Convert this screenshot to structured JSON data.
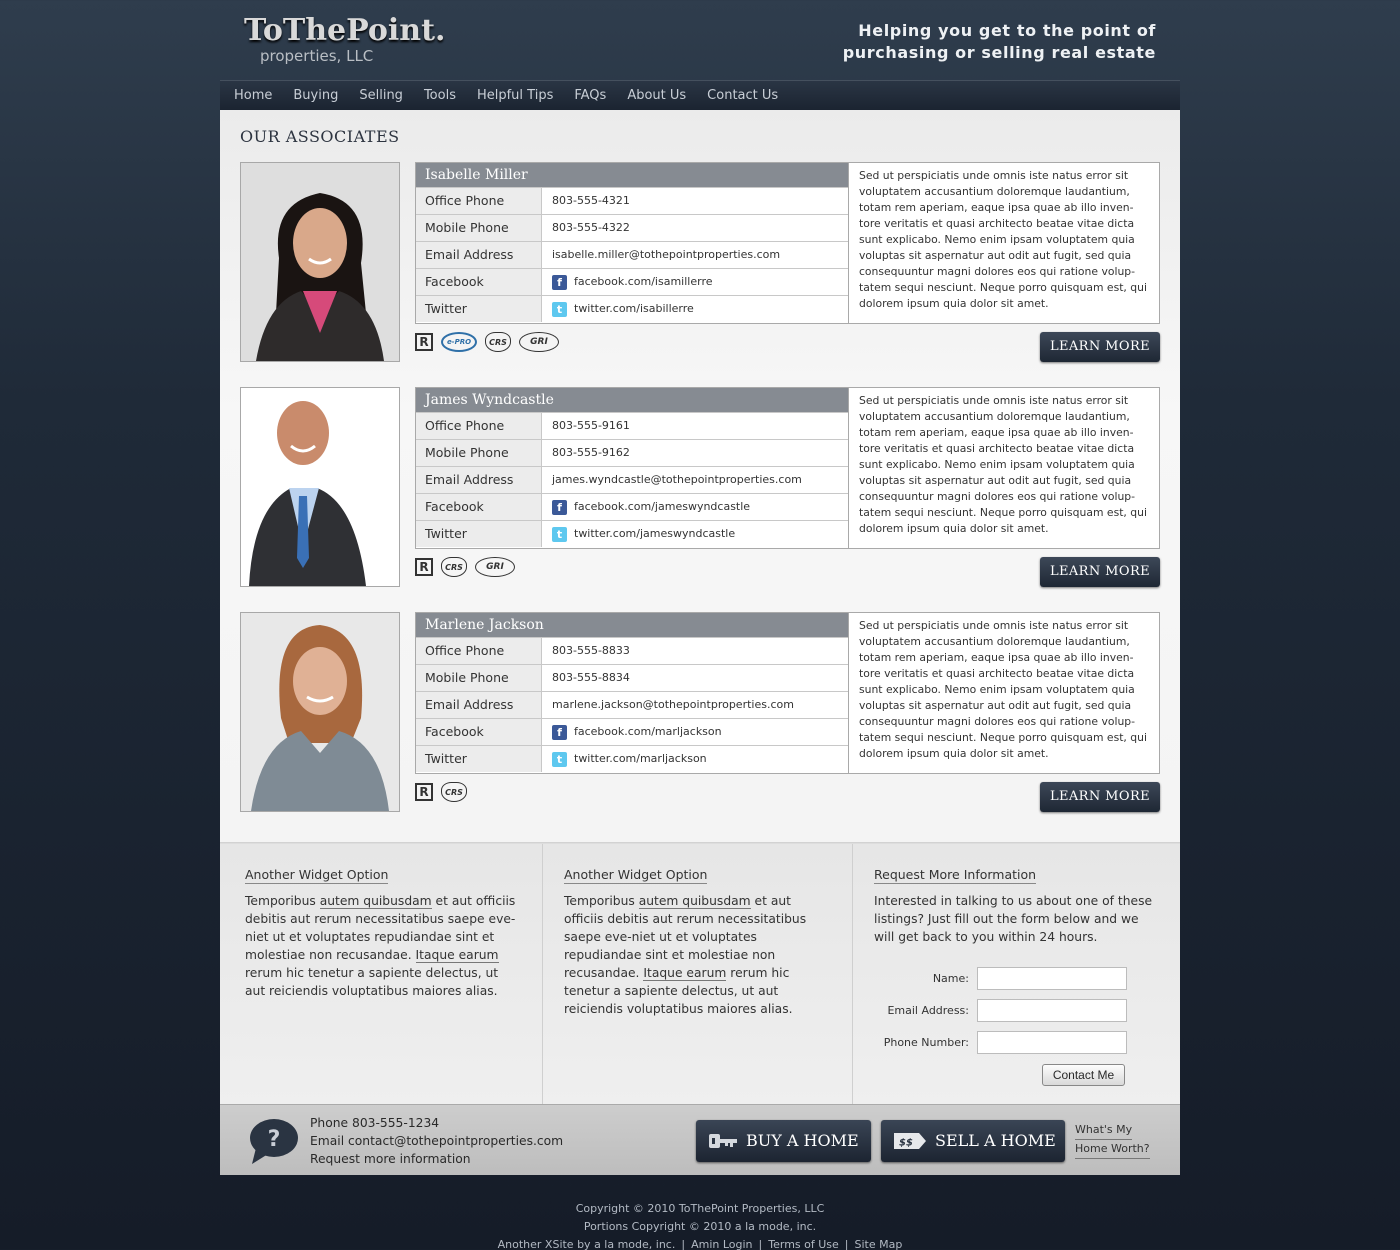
{
  "header": {
    "logo_main": "ToThePoint.",
    "logo_sub": "properties, LLC",
    "tagline_line1": "Helping you get to the point of",
    "tagline_line2": "purchasing or selling real estate"
  },
  "nav": [
    "Home",
    "Buying",
    "Selling",
    "Tools",
    "Helpful Tips",
    "FAQs",
    "About Us",
    "Contact Us"
  ],
  "section_title": "OUR ASSOCIATES",
  "labels": {
    "office": "Office Phone",
    "mobile": "Mobile Phone",
    "email": "Email Address",
    "facebook": "Facebook",
    "twitter": "Twitter",
    "learn_more": "LEARN MORE"
  },
  "bio": "Sed ut perspiciatis unde omnis iste natus error sit voluptatem accusantium doloremque laudantium, totam rem aperiam, eaque ipsa quae ab illo inven-tore veritatis et quasi architecto beatae vitae dicta sunt explicabo. Nemo enim ipsam voluptatem quia voluptas sit aspernatur aut odit aut fugit, sed quia consequuntur magni dolores eos qui ratione volup-tatem sequi nesciunt. Neque porro quisquam est, qui dolorem ipsum quia dolor sit amet.",
  "associates": [
    {
      "name": "Isabelle Miller",
      "office": "803-555-4321",
      "mobile": "803-555-4322",
      "email": "isabelle.miller@tothepointproperties.com",
      "facebook": "facebook.com/isamillerre",
      "twitter": "twitter.com/isabillerre",
      "badges": [
        "R",
        "e-PRO",
        "CRS",
        "GRI"
      ]
    },
    {
      "name": "James Wyndcastle",
      "office": "803-555-9161",
      "mobile": "803-555-9162",
      "email": "james.wyndcastle@tothepointproperties.com",
      "facebook": "facebook.com/jameswyndcastle",
      "twitter": "twitter.com/jameswyndcastle",
      "badges": [
        "R",
        "CRS",
        "GRI"
      ]
    },
    {
      "name": "Marlene Jackson",
      "office": "803-555-8833",
      "mobile": "803-555-8834",
      "email": "marlene.jackson@tothepointproperties.com",
      "facebook": "facebook.com/marljackson",
      "twitter": "twitter.com/marljackson",
      "badges": [
        "R",
        "CRS"
      ]
    }
  ],
  "widgets": {
    "w1_title": "Another Widget Option",
    "w2_title": "Another Widget Option",
    "text_a": "Temporibus ",
    "text_link1": "autem quibusdam",
    "text_b": " et aut officiis debitis aut rerum necessitatibus saepe eve-niet ut et voluptates repudiandae sint et molestiae non recusandae. ",
    "text_link2": "Itaque earum",
    "text_c": " rerum hic tenetur a sapiente delectus, ut aut reiciendis voluptatibus maiores alias.",
    "w3_title": "Request More Information",
    "w3_text": "Interested in talking to us about one of these listings? Just fill out the form below and we will get back to you within 24 hours.",
    "name_label": "Name:",
    "email_label": "Email Address:",
    "phone_label": "Phone Number:",
    "submit": "Contact Me"
  },
  "contact_bar": {
    "phone": "Phone 803-555-1234",
    "email": "Email contact@tothepointproperties.com",
    "request": "Request more information",
    "buy": "BUY A HOME",
    "sell": "SELL A HOME",
    "sell_icon_text": "$$",
    "worth1": "What's My",
    "worth2": "Home Worth?"
  },
  "footer": {
    "line1": "Copyright © 2010 ToThePoint Properties, LLC",
    "line2": "Portions Copyright © 2010 a la mode, inc.",
    "link1": "Another XSite by a la mode, inc.",
    "link2": "Amin Login",
    "link3": "Terms of Use",
    "link4": "Site Map"
  },
  "colors": {
    "accent_dark": "#1e2734",
    "name_bar": "#868b92",
    "facebook": "#3b5998",
    "twitter": "#5ec8ef"
  }
}
